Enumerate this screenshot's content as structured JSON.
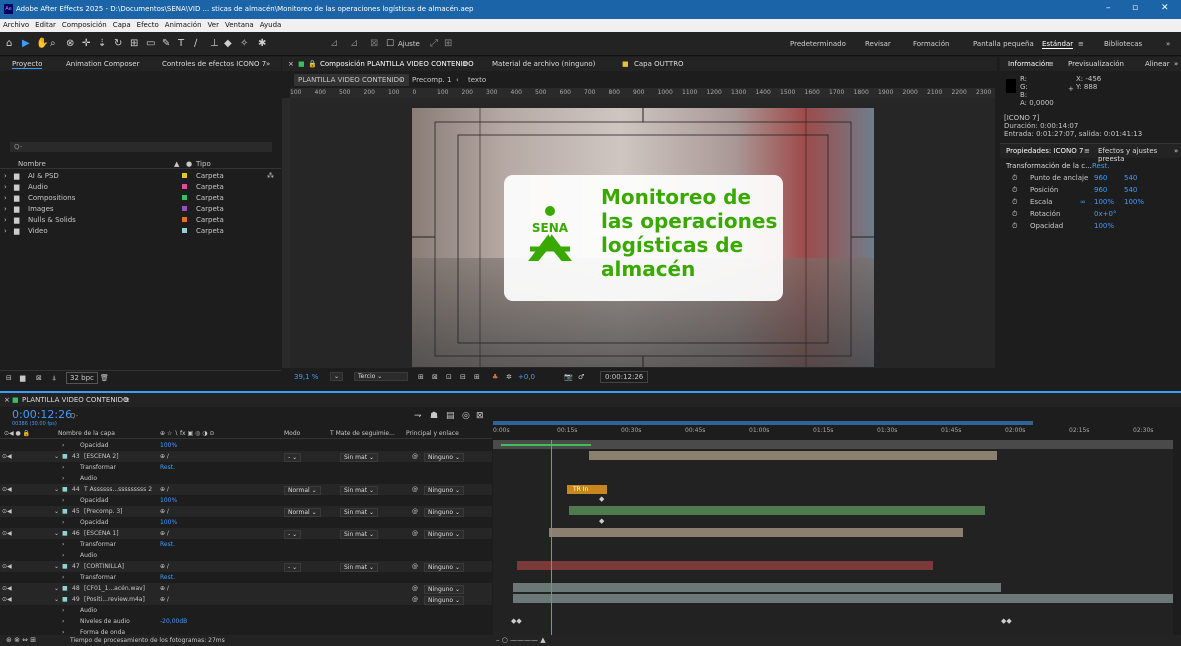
{
  "title": "Adobe After Effects 2025 - D:\\Documentos\\SENA\\VID ... sticas de almacén\\Monitoreo de las operaciones logísticas de almacén.aep",
  "app_logo": "Ae",
  "window_controls": {
    "min": "–",
    "max": "▫",
    "close": "✕"
  },
  "menu": [
    "Archivo",
    "Editar",
    "Composición",
    "Capa",
    "Efecto",
    "Animación",
    "Ver",
    "Ventana",
    "Ayuda"
  ],
  "toolbar": {
    "snap_label": "Ajuste",
    "workspaces": [
      "Predeterminado",
      "Revisar",
      "Formación",
      "Pantalla pequeña",
      "Estándar",
      "Bibliotecas"
    ],
    "active_workspace": "Estándar",
    "more": "»"
  },
  "project": {
    "tabs": [
      "Proyecto",
      "Animation Composer",
      "Controles de efectos ICONO 7"
    ],
    "search_placeholder": "Q-",
    "col_name": "Nombre",
    "col_type": "Tipo",
    "items": [
      {
        "name": "AI & PSD",
        "type": "Carpeta",
        "color": "#e6c52a"
      },
      {
        "name": "Audio",
        "type": "Carpeta",
        "color": "#d94f9b"
      },
      {
        "name": "Compositions",
        "type": "Carpeta",
        "color": "#3cbf5c"
      },
      {
        "name": "Images",
        "type": "Carpeta",
        "color": "#a04cc8"
      },
      {
        "name": "Nulls & Solids",
        "type": "Carpeta",
        "color": "#e0732b"
      },
      {
        "name": "Video",
        "type": "Carpeta",
        "color": "#8fd2d6"
      }
    ],
    "bpc": "32 bpc"
  },
  "comp": {
    "tab": "Composición PLANTILLA VIDEO CONTENIDO",
    "footage_tab": "Material de archivo (ninguno)",
    "layer_tab": "Capa OUTTRO",
    "breadcrumbs": [
      "PLANTILLA VIDEO CONTENIDO",
      "Precomp. 1",
      "texto"
    ],
    "ruler": [
      "100",
      "400",
      "500",
      "200",
      "100",
      "0",
      "100",
      "200",
      "300",
      "400",
      "500",
      "600",
      "700",
      "800",
      "900",
      "1000",
      "1100",
      "1200",
      "1300",
      "1400",
      "1500",
      "1600",
      "1700",
      "1800",
      "1900",
      "2000",
      "2100",
      "2200",
      "2300"
    ],
    "card_title": "Monitoreo de las operaciones logísticas de almacén",
    "logo_text": "SENA",
    "zoom": "39,1 %",
    "resolution": "Tercio",
    "exposure": "+0,0",
    "timecode": "0:00:12:26"
  },
  "info": {
    "tabs": [
      "Información",
      "Previsualización",
      "Alinear"
    ],
    "r": "R:",
    "g": "G:",
    "b": "B:",
    "a": "A: 0,0000",
    "x": "X: -456",
    "y": "Y: 888",
    "layer": "[ICONO 7]",
    "duration": "Duración: 0:00:14:07",
    "inout": "Entrada: 0:01:27:07, salida: 0:01:41:13"
  },
  "properties": {
    "tabs": [
      "Propiedades: ICONO 7",
      "Efectos y ajustes preesta"
    ],
    "section": "Transformación de la c...",
    "reset": "Rest.",
    "rows": [
      {
        "name": "Punto de anclaje",
        "v1": "960",
        "v2": "540"
      },
      {
        "name": "Posición",
        "v1": "960",
        "v2": "540"
      },
      {
        "name": "Escala",
        "v1": "100%",
        "v2": "100%"
      },
      {
        "name": "Rotación",
        "v1": "0x+0°",
        "v2": ""
      },
      {
        "name": "Opacidad",
        "v1": "100%",
        "v2": ""
      }
    ]
  },
  "timeline": {
    "tab": "PLANTILLA VIDEO CONTENIDO",
    "timecode": "0:00:12:26",
    "fps": "00386 (30.00 fps)",
    "cols": {
      "name": "Nombre de la capa",
      "mode": "Modo",
      "track": "T  Mate de seguimie...",
      "parent": "Principal y enlace"
    },
    "ticks": [
      "0:00s",
      "00:15s",
      "00:30s",
      "00:45s",
      "01:00s",
      "01:15s",
      "01:30s",
      "01:45s",
      "02:00s",
      "02:15s",
      "02:30s"
    ],
    "layers": [
      {
        "indent": "",
        "label": "Opacidad",
        "val": "100%",
        "mode": "",
        "mate": "",
        "parent": ""
      },
      {
        "indent": "43",
        "label": "[ESCENA 2]",
        "val": "",
        "mode": "-",
        "mate": "Sin mat",
        "parent": "Ninguno"
      },
      {
        "indent": "",
        "label": "Transformar",
        "val": "Rest.",
        "mode": "",
        "mate": "",
        "parent": ""
      },
      {
        "indent": "",
        "label": "Audio",
        "val": "",
        "mode": "",
        "mate": "",
        "parent": ""
      },
      {
        "indent": "44",
        "label": "T  Assssss...sssssssss 2",
        "val": "",
        "mode": "Normal",
        "mate": "Sin mat",
        "parent": "Ninguno"
      },
      {
        "indent": "",
        "label": "Opacidad",
        "val": "100%",
        "mode": "",
        "mate": "",
        "parent": ""
      },
      {
        "indent": "45",
        "label": "[Precomp. 3]",
        "val": "",
        "mode": "Normal",
        "mate": "Sin mat",
        "parent": "Ninguno"
      },
      {
        "indent": "",
        "label": "Opacidad",
        "val": "100%",
        "mode": "",
        "mate": "",
        "parent": ""
      },
      {
        "indent": "46",
        "label": "[ESCENA 1]",
        "val": "",
        "mode": "-",
        "mate": "Sin mat",
        "parent": "Ninguno"
      },
      {
        "indent": "",
        "label": "Transformar",
        "val": "Rest.",
        "mode": "",
        "mate": "",
        "parent": ""
      },
      {
        "indent": "",
        "label": "Audio",
        "val": "",
        "mode": "",
        "mate": "",
        "parent": ""
      },
      {
        "indent": "47",
        "label": "[CORTINILLA]",
        "val": "",
        "mode": "-",
        "mate": "Sin mat",
        "parent": "Ninguno"
      },
      {
        "indent": "",
        "label": "Transformar",
        "val": "Rest.",
        "mode": "",
        "mate": "",
        "parent": ""
      },
      {
        "indent": "48",
        "label": "[CF01_1...acén.wav]",
        "val": "",
        "mode": "",
        "mate": "",
        "parent": "Ninguno"
      },
      {
        "indent": "49",
        "label": "[Positi...review.m4a]",
        "val": "",
        "mode": "",
        "mate": "",
        "parent": "Ninguno"
      },
      {
        "indent": "",
        "label": "Audio",
        "val": "",
        "mode": "",
        "mate": "",
        "parent": ""
      },
      {
        "indent": "",
        "label": "Niveles de audio",
        "val": "-20,00dB",
        "mode": "",
        "mate": "",
        "parent": ""
      },
      {
        "indent": "",
        "label": "Forma de onda",
        "val": "",
        "mode": "",
        "mate": "",
        "parent": ""
      }
    ],
    "tr_label": "TR In",
    "status": "Tiempo de procesamiento de los fotogramas: 27ms"
  }
}
